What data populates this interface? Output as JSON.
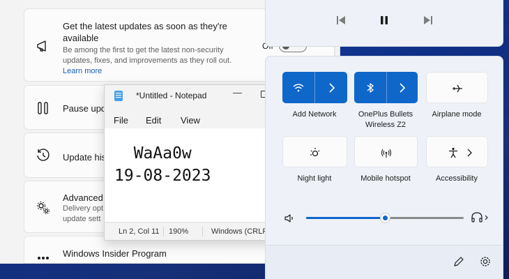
{
  "settings": {
    "cards": [
      {
        "title": "Get the latest updates as soon as they're available",
        "description": "Be among the first to get the latest non-security updates, fixes, and improvements as they roll out.",
        "link": "Learn more",
        "toggle_label": "Off",
        "icon": "megaphone-icon"
      },
      {
        "title": "Pause upd",
        "icon": "pause-icon"
      },
      {
        "title": "Update his",
        "icon": "history-icon"
      },
      {
        "title": "Advanced",
        "description_lines": [
          "Delivery opt",
          "update sett"
        ],
        "icon": "gears-icon"
      },
      {
        "title": "Windows Insider Program",
        "icon": "insider-icon"
      }
    ]
  },
  "notepad": {
    "title": "*Untitled - Notepad",
    "menu": [
      "File",
      "Edit",
      "View"
    ],
    "content": "  WaAa0w\n19-08-2023",
    "status": {
      "position": "Ln 2, Col 11",
      "zoom": "190%",
      "line_ending": "Windows (CRLF"
    }
  },
  "media": {
    "buttons": [
      "previous-icon",
      "pause-icon",
      "next-icon"
    ]
  },
  "quick_settings": {
    "tiles": [
      {
        "label": "Add Network",
        "icon": "wifi-icon",
        "active": true,
        "has_chevron": true
      },
      {
        "label": "OnePlus Bullets Wireless Z2",
        "icon": "bluetooth-icon",
        "active": true,
        "has_chevron": true
      },
      {
        "label": "Airplane mode",
        "icon": "airplane-icon",
        "active": false,
        "has_chevron": false
      },
      {
        "label": "Night light",
        "icon": "night-light-icon",
        "active": false,
        "has_chevron": false
      },
      {
        "label": "Mobile hotspot",
        "icon": "hotspot-icon",
        "active": false,
        "has_chevron": false
      },
      {
        "label": "Accessibility",
        "icon": "accessibility-icon",
        "active": false,
        "has_chevron": true
      }
    ],
    "volume": {
      "level_percent": 50
    },
    "bottom_icons": [
      "edit-icon",
      "settings-icon"
    ],
    "accent_color": "#0f67c9"
  }
}
